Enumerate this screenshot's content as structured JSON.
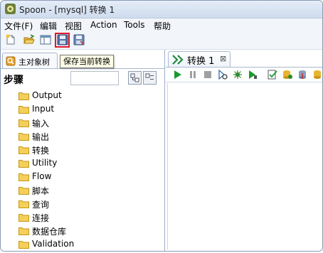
{
  "window": {
    "title": "Spoon - [mysql] 转换 1"
  },
  "menu": [
    "文件(F)",
    "编辑",
    "视图",
    "Action",
    "Tools",
    "帮助"
  ],
  "toolbar": {
    "buttons": [
      "new-file",
      "open-folder",
      "explore",
      "save",
      "save-as"
    ],
    "tooltip": "保存当前转换"
  },
  "left_panel": {
    "tab_label": "主对象树",
    "steps_heading": "步骤",
    "tree_items": [
      "Output",
      "Input",
      "输入",
      "输出",
      "转换",
      "Utility",
      "Flow",
      "脚本",
      "查询",
      "连接",
      "数据仓库",
      "Validation"
    ]
  },
  "right_panel": {
    "tab_label": "转换 1",
    "tab_close": "⊠"
  },
  "colors": {
    "folder": "#f1c232",
    "run_green": "#1b9a2f",
    "highlight_red": "#e0182b",
    "titlebar": "#d6e2f1"
  }
}
